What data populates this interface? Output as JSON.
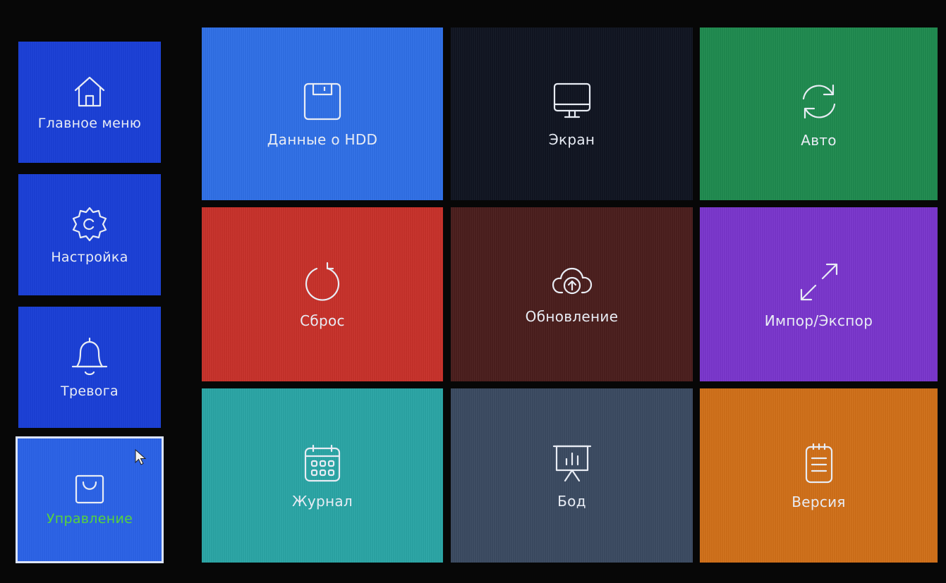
{
  "sidebar": {
    "items": [
      {
        "label": "Главное меню",
        "icon": "home-icon"
      },
      {
        "label": "Настройка",
        "icon": "gear-icon"
      },
      {
        "label": "Тревога",
        "icon": "bell-icon"
      },
      {
        "label": "Управление",
        "icon": "shopping-bag-icon",
        "selected": true
      }
    ]
  },
  "tiles": [
    {
      "label": "Данные о HDD",
      "icon": "floppy-disk-icon",
      "color": "#2f6fe6"
    },
    {
      "label": "Экран",
      "icon": "monitor-icon",
      "color": "#101521"
    },
    {
      "label": "Авто",
      "icon": "refresh-icon",
      "color": "#1f8a4f"
    },
    {
      "label": "Сброс",
      "icon": "reset-icon",
      "color": "#c7312a"
    },
    {
      "label": "Обновление",
      "icon": "cloud-upload-icon",
      "color": "#4a1e1d"
    },
    {
      "label": "Импор/Экспор",
      "icon": "expand-arrows-icon",
      "color": "#7a36cc"
    },
    {
      "label": "Журнал",
      "icon": "calendar-icon",
      "color": "#2aa5a5"
    },
    {
      "label": "Бод",
      "icon": "presentation-chart-icon",
      "color": "#3b4a61"
    },
    {
      "label": "Версия",
      "icon": "clipboard-icon",
      "color": "#d07019"
    }
  ],
  "colors": {
    "sidebar": "#1b3fd6",
    "sidebar_active": "#2b62e6",
    "active_label": "#57d33c",
    "background": "#070707"
  }
}
